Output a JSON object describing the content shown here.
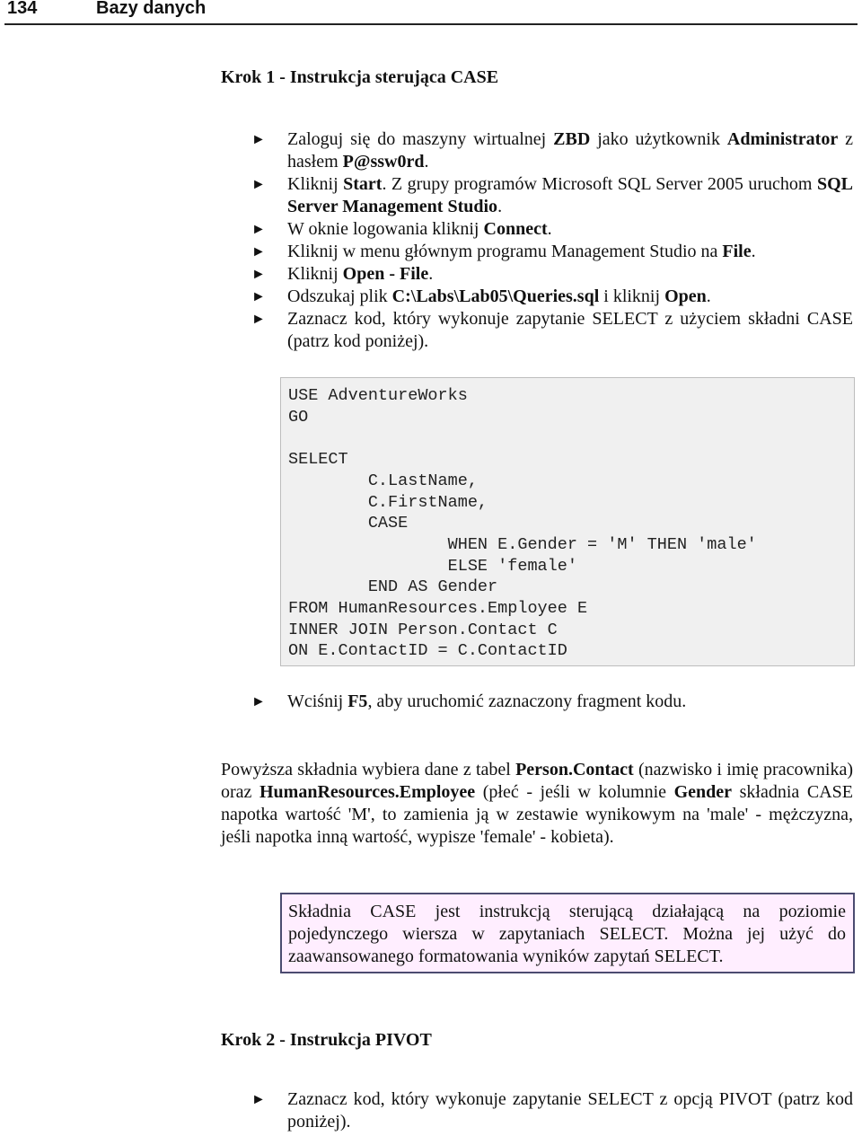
{
  "header": {
    "page_number": "134",
    "title": "Bazy danych"
  },
  "step1": {
    "heading": "Krok 1 - Instrukcja sterująca CASE",
    "bullets": [
      {
        "parts": [
          [
            "n",
            "Zaloguj się do maszyny wirtualnej "
          ],
          [
            "b",
            "ZBD"
          ],
          [
            "n",
            " jako użytkownik "
          ],
          [
            "b",
            "Administrator"
          ],
          [
            "n",
            " z hasłem "
          ],
          [
            "b",
            "P@ssw0rd"
          ],
          [
            "n",
            "."
          ]
        ]
      },
      {
        "parts": [
          [
            "n",
            "Kliknij "
          ],
          [
            "b",
            "Start"
          ],
          [
            "n",
            ". Z grupy programów Microsoft SQL Server 2005 uruchom "
          ],
          [
            "b",
            "SQL Server Management Studio"
          ],
          [
            "n",
            "."
          ]
        ]
      },
      {
        "parts": [
          [
            "n",
            "W oknie logowania kliknij "
          ],
          [
            "b",
            "Connect"
          ],
          [
            "n",
            "."
          ]
        ]
      },
      {
        "parts": [
          [
            "n",
            "Kliknij w menu głównym programu Management Studio na "
          ],
          [
            "b",
            "File"
          ],
          [
            "n",
            "."
          ]
        ]
      },
      {
        "parts": [
          [
            "n",
            "Kliknij "
          ],
          [
            "b",
            "Open - File"
          ],
          [
            "n",
            "."
          ]
        ]
      },
      {
        "parts": [
          [
            "n",
            "Odszukaj plik "
          ],
          [
            "b",
            "C:\\Labs\\Lab05\\Queries.sql"
          ],
          [
            "n",
            " i kliknij "
          ],
          [
            "b",
            "Open"
          ],
          [
            "n",
            "."
          ]
        ]
      },
      {
        "parts": [
          [
            "n",
            "Zaznacz kod, który wykonuje zapytanie SELECT z użyciem składni CASE (patrz kod poniżej)."
          ]
        ]
      }
    ],
    "code": "USE AdventureWorks\nGO\n\nSELECT\n        C.LastName,\n        C.FirstName,\n        CASE\n                WHEN E.Gender = 'M' THEN 'male'\n                ELSE 'female'\n        END AS Gender\nFROM HumanResources.Employee E\nINNER JOIN Person.Contact C\nON E.ContactID = C.ContactID",
    "run_bullet": {
      "parts": [
        [
          "n",
          "Wciśnij "
        ],
        [
          "b",
          "F5"
        ],
        [
          "n",
          ", aby uruchomić zaznaczony fragment kodu."
        ]
      ]
    },
    "explanation": {
      "parts": [
        [
          "n",
          "Powyższa składnia wybiera dane z tabel "
        ],
        [
          "b",
          "Person.Contact"
        ],
        [
          "n",
          " (nazwisko i imię pracownika) oraz "
        ],
        [
          "b",
          "HumanResources.Employee"
        ],
        [
          "n",
          " (płeć - jeśli w kolumnie "
        ],
        [
          "b",
          "Gender"
        ],
        [
          "n",
          " składnia CASE napotka wartość 'M', to zamienia ją w zestawie wynikowym na 'male' - mężczyzna, jeśli napotka inną wartość, wypisze 'female' - kobieta)."
        ]
      ]
    },
    "note": "Składnia CASE jest instrukcją sterującą działającą na poziomie pojedynczego wiersza w zapytaniach SELECT. Można jej użyć do zaawansowanego formatowania wyników zapytań SELECT."
  },
  "step2": {
    "heading": "Krok 2 - Instrukcja PIVOT",
    "bullets": [
      {
        "parts": [
          [
            "n",
            "Zaznacz kod, który wykonuje zapytanie SELECT z opcją PIVOT (patrz kod poniżej)."
          ]
        ]
      }
    ]
  },
  "icons": {
    "bullet": "►"
  },
  "colors": {
    "code_bg": "#f0f0f0",
    "note_bg": "#ffeeff",
    "note_border": "#4b4b70"
  }
}
